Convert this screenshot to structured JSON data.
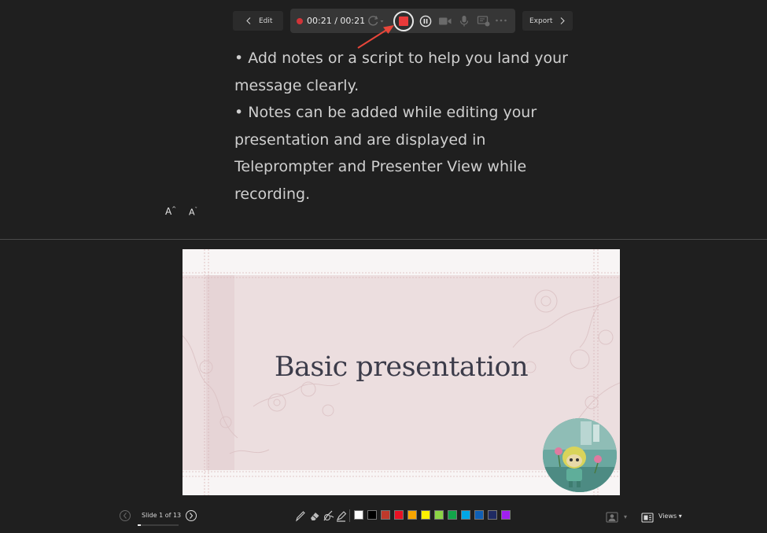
{
  "toolbar": {
    "edit_label": "Edit",
    "export_label": "Export",
    "timer": "00:21 / 00:21",
    "icons": {
      "recording": "recording-dot-icon",
      "retake": "retake-icon",
      "stop": "stop-icon",
      "pause": "pause-icon",
      "camera": "camera-icon",
      "microphone": "microphone-icon",
      "screen": "screen-icon",
      "more": "more-icon"
    }
  },
  "notes": {
    "lines": [
      "• Add notes or a script to help you land your message clearly.",
      "• Notes can be added while editing your presentation and are displayed in Teleprompter and Presenter View while recording."
    ],
    "font_increase_label": "A",
    "font_decrease_label": "A"
  },
  "slide": {
    "title": "Basic presentation"
  },
  "bottom_bar": {
    "slide_count": "Slide 1 of 13",
    "slide_position": 1,
    "slide_total": 13,
    "views_label": "Views ▾",
    "camera_caret": "▾",
    "tools": [
      "pen-icon",
      "eraser-icon",
      "laser-pointer-icon",
      "highlighter-icon"
    ],
    "swatches": [
      "#ffffff",
      "#000000",
      "#c0392b",
      "#e81123",
      "#f7a500",
      "#fff100",
      "#8cd445",
      "#12a54a",
      "#00a7e6",
      "#0f5fb5",
      "#1e2a63",
      "#a020f0"
    ]
  },
  "colors": {
    "background": "#1f1f1f",
    "record_red": "#e83a3a",
    "annotation_arrow": "#e8463a"
  }
}
